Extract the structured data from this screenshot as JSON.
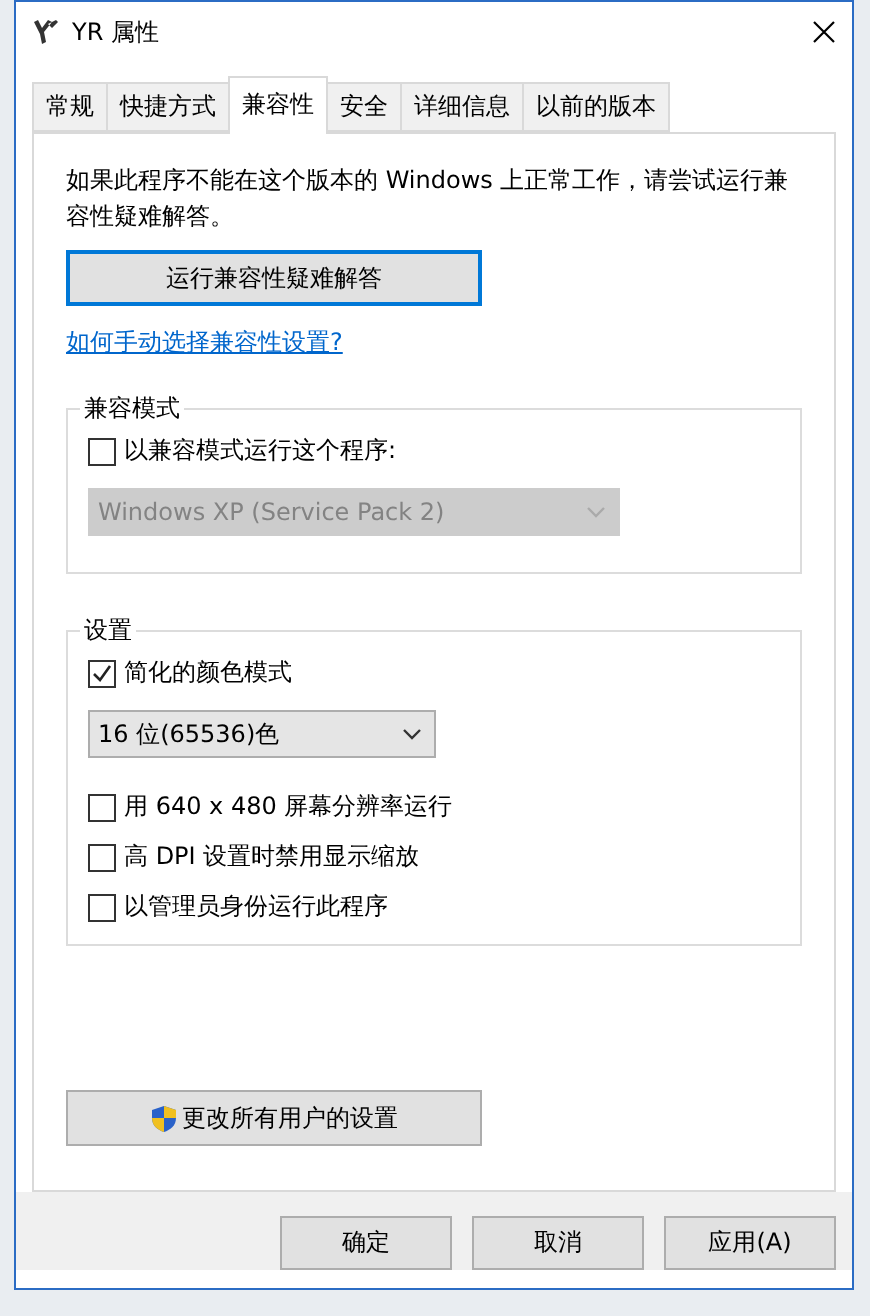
{
  "window": {
    "title": "YR 属性"
  },
  "tabs": [
    {
      "label": "常规",
      "selected": false
    },
    {
      "label": "快捷方式",
      "selected": false
    },
    {
      "label": "兼容性",
      "selected": true
    },
    {
      "label": "安全",
      "selected": false
    },
    {
      "label": "详细信息",
      "selected": false
    },
    {
      "label": "以前的版本",
      "selected": false
    }
  ],
  "intro": "如果此程序不能在这个版本的 Windows 上正常工作，请尝试运行兼容性疑难解答。",
  "troubleshoot_button": "运行兼容性疑难解答",
  "help_link": "如何手动选择兼容性设置?",
  "compat_mode": {
    "title": "兼容模式",
    "items": [
      {
        "kind": "checkbox",
        "label": "以兼容模式运行这个程序:",
        "checked": false
      },
      {
        "kind": "dropdown",
        "value": "Windows XP (Service Pack 2)",
        "disabled": true
      }
    ]
  },
  "settings": {
    "title": "设置",
    "items": [
      {
        "kind": "checkbox",
        "label": "简化的颜色模式",
        "checked": true
      },
      {
        "kind": "dropdown",
        "value": "16 位(65536)色",
        "disabled": false
      },
      {
        "kind": "checkbox",
        "label": "用 640 x 480 屏幕分辨率运行",
        "checked": false
      },
      {
        "kind": "checkbox",
        "label": "高 DPI 设置时禁用显示缩放",
        "checked": false
      },
      {
        "kind": "checkbox",
        "label": "以管理员身份运行此程序",
        "checked": false
      }
    ]
  },
  "all_users_button": "更改所有用户的设置",
  "buttons": [
    "确定",
    "取消",
    "应用(A)"
  ]
}
